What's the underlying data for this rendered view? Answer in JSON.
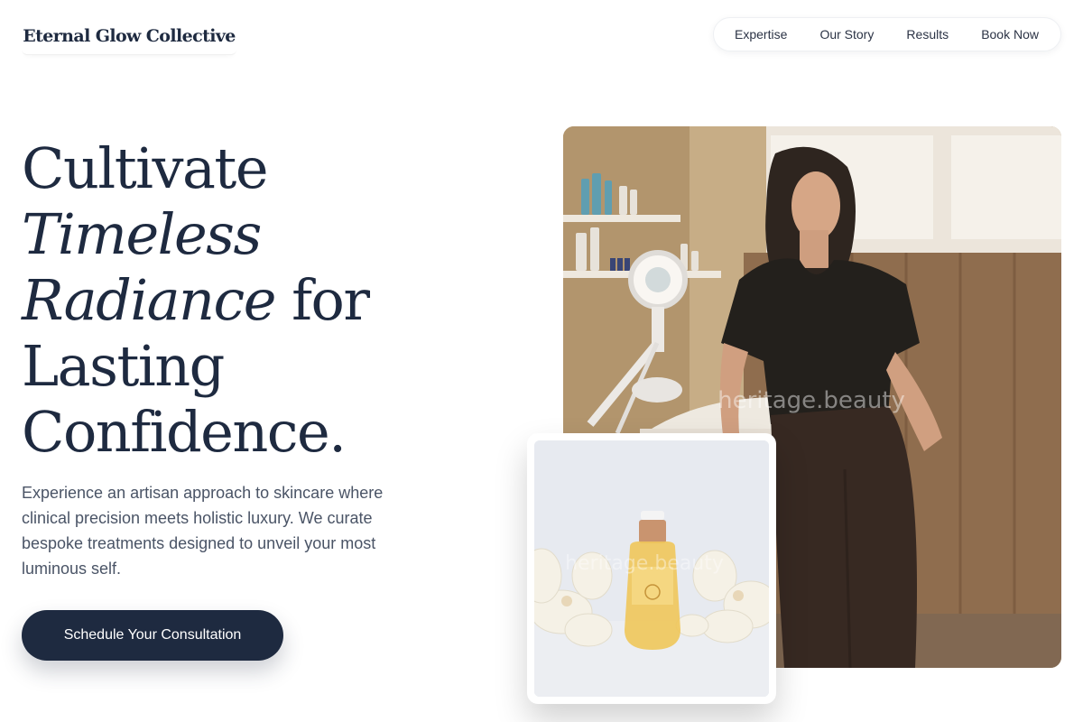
{
  "brand": {
    "name": "Eternal Glow Collective"
  },
  "nav": {
    "items": [
      {
        "label": "Expertise"
      },
      {
        "label": "Our Story"
      },
      {
        "label": "Results"
      },
      {
        "label": "Book Now"
      }
    ]
  },
  "hero": {
    "headline_line1": "Cultivate",
    "headline_italic1": "Timeless",
    "headline_italic2": "Radiance",
    "headline_for": " for",
    "headline_line4": "Lasting",
    "headline_line5": "Confidence.",
    "intro": "Experience an artisan approach to skincare where clinical precision meets holistic luxury. We curate bespoke treatments designed to unveil your most luminous self.",
    "cta_label": "Schedule Your Consultation"
  },
  "images": {
    "hero_watermark": "heritage.beauty",
    "product_watermark": "heritage.beauty"
  },
  "colors": {
    "navy": "#1e2a40",
    "body_text": "#4a5466",
    "background": "#ffffff"
  }
}
